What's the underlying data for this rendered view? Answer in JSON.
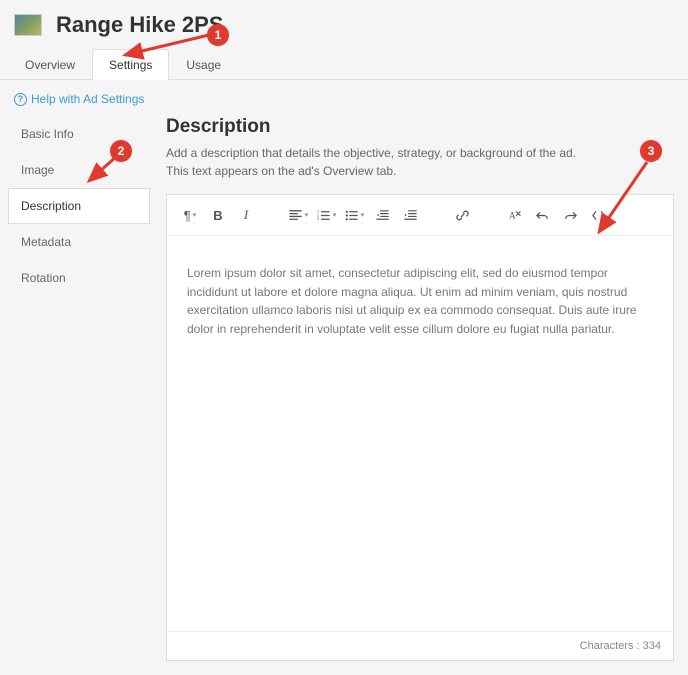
{
  "header": {
    "title": "Range Hike 2PS"
  },
  "tabs": [
    {
      "label": "Overview",
      "active": false
    },
    {
      "label": "Settings",
      "active": true
    },
    {
      "label": "Usage",
      "active": false
    }
  ],
  "help": {
    "label": "Help with Ad Settings"
  },
  "sidebar": {
    "items": [
      {
        "label": "Basic Info",
        "active": false
      },
      {
        "label": "Image",
        "active": false
      },
      {
        "label": "Description",
        "active": true
      },
      {
        "label": "Metadata",
        "active": false
      },
      {
        "label": "Rotation",
        "active": false
      }
    ]
  },
  "content": {
    "heading": "Description",
    "line1": "Add a description that details the objective, strategy, or background of the ad.",
    "line2": "This text appears on the ad's Overview tab."
  },
  "editor": {
    "body": "Lorem ipsum dolor sit amet, consectetur adipiscing elit, sed do eiusmod tempor incididunt ut labore et dolore magna aliqua. Ut enim ad minim veniam, quis nostrud exercitation ullamco laboris nisi ut aliquip ex ea commodo consequat. Duis aute irure dolor in reprehenderit in voluptate velit esse cillum dolore eu fugiat nulla pariatur.",
    "footer_label": "Characters",
    "char_count": "334"
  },
  "annotations": {
    "b1": "1",
    "b2": "2",
    "b3": "3"
  }
}
